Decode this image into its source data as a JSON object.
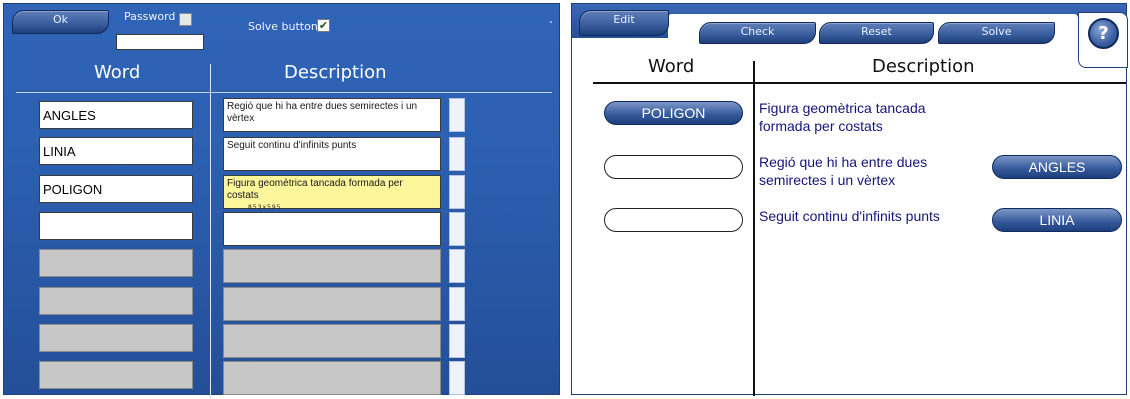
{
  "editor": {
    "ok_label": "Ok",
    "password_label": "Password",
    "solve_button_label": "Solve button",
    "solve_button_checked": "✔",
    "corner_mark": "\"",
    "header_word": "Word",
    "header_description": "Description",
    "rows": [
      {
        "word": "ANGLES",
        "description": "Regió que hi ha entre dues semirectes i un vèrtex"
      },
      {
        "word": "LINIA",
        "description": "Seguit continu d'infinits punts"
      },
      {
        "word": "POLIGON",
        "description": "Figura geomètrica tancada formada per costats"
      },
      {
        "word": "",
        "description": ""
      },
      {
        "word": "",
        "description": ""
      },
      {
        "word": "",
        "description": ""
      },
      {
        "word": "",
        "description": ""
      },
      {
        "word": "",
        "description": ""
      }
    ],
    "selected_row_snippet": "853x595"
  },
  "preview": {
    "edit_label": "Edit",
    "check_label": "Check",
    "reset_label": "Reset",
    "solve_label": "Solve",
    "help_label": "?",
    "header_word": "Word",
    "header_description": "Description",
    "rows": [
      {
        "answer": "POLIGON",
        "description_line1": "Figura geomètrica tancada",
        "description_line2": "formada per costats",
        "choice": ""
      },
      {
        "answer": "",
        "description_line1": "Regió que hi ha entre dues",
        "description_line2": "semirectes i un vèrtex",
        "choice": "ANGLES"
      },
      {
        "answer": "",
        "description_line1": "Seguit continu d'infinits punts",
        "description_line2": "",
        "choice": "LINIA"
      }
    ]
  },
  "colors": {
    "panel_blue": "#2b5fb0",
    "selected_yellow": "#fdf69b",
    "description_text": "#15157a"
  }
}
